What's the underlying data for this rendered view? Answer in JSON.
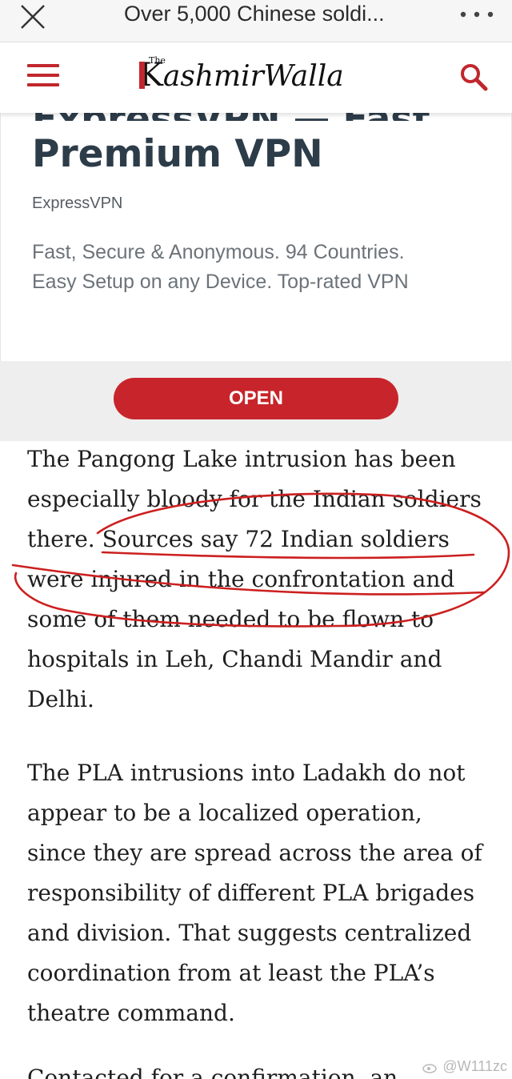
{
  "browser": {
    "title": "Over 5,000 Chinese soldi...",
    "close_icon": "close-icon",
    "more_icon": "more-dots-icon"
  },
  "site": {
    "logo_the": "The",
    "logo_k": "K",
    "logo_rest": "ashmirWalla",
    "menu_icon": "hamburger-menu-icon",
    "search_icon": "search-icon",
    "accent_color": "#c0272d"
  },
  "ad": {
    "headline_clipped": "ExpressVPN — Fast",
    "headline": "Premium VPN",
    "brand": "ExpressVPN",
    "description_lines": [
      "Fast, Secure & Anonymous. 94 Countries.",
      "Easy Setup on any Device. Top-rated VPN"
    ],
    "button_label": "OPEN",
    "button_color": "#c7252b"
  },
  "article": {
    "paragraph1": [
      "The Pangong Lake intrusion has been",
      "especially bloody for the Indian soldiers",
      "there. Sources say 72 Indian soldiers",
      "were injured in the confrontation and",
      "some of them needed to be flown to",
      "hospitals in Leh, Chandi Mandir and",
      "Delhi."
    ],
    "paragraph2": [
      "The PLA intrusions into Ladakh do not",
      "appear to be a localized operation,",
      "since they are spread across the area of",
      "responsibility of different PLA brigades",
      "and division. That suggests centralized",
      "coordination from at least the PLA’s",
      "theatre command."
    ],
    "cut_line": "Contacted for a confirmation, an"
  },
  "watermark": {
    "text": "@W111zc",
    "icon": "weibo-icon"
  }
}
